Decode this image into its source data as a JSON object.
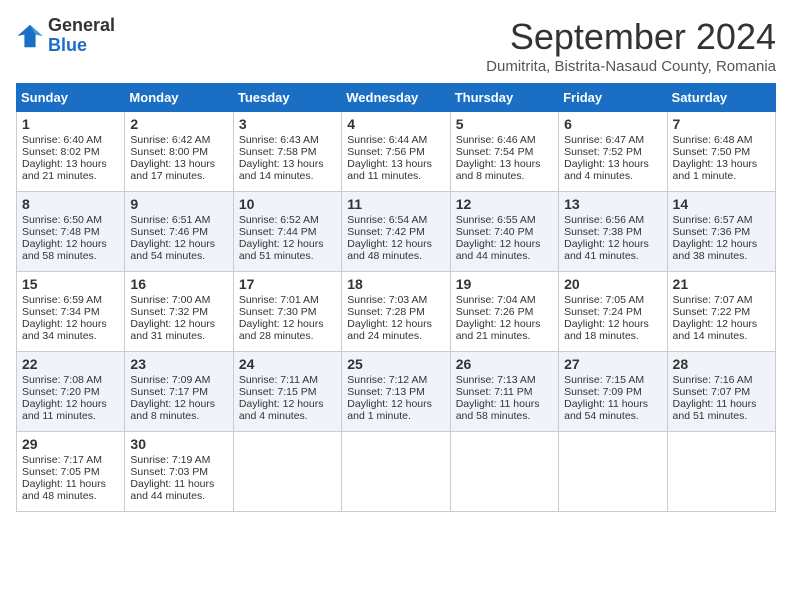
{
  "header": {
    "logo_general": "General",
    "logo_blue": "Blue",
    "month_title": "September 2024",
    "subtitle": "Dumitrita, Bistrita-Nasaud County, Romania"
  },
  "columns": [
    "Sunday",
    "Monday",
    "Tuesday",
    "Wednesday",
    "Thursday",
    "Friday",
    "Saturday"
  ],
  "weeks": [
    [
      {
        "day": "1",
        "lines": [
          "Sunrise: 6:40 AM",
          "Sunset: 8:02 PM",
          "Daylight: 13 hours",
          "and 21 minutes."
        ]
      },
      {
        "day": "2",
        "lines": [
          "Sunrise: 6:42 AM",
          "Sunset: 8:00 PM",
          "Daylight: 13 hours",
          "and 17 minutes."
        ]
      },
      {
        "day": "3",
        "lines": [
          "Sunrise: 6:43 AM",
          "Sunset: 7:58 PM",
          "Daylight: 13 hours",
          "and 14 minutes."
        ]
      },
      {
        "day": "4",
        "lines": [
          "Sunrise: 6:44 AM",
          "Sunset: 7:56 PM",
          "Daylight: 13 hours",
          "and 11 minutes."
        ]
      },
      {
        "day": "5",
        "lines": [
          "Sunrise: 6:46 AM",
          "Sunset: 7:54 PM",
          "Daylight: 13 hours",
          "and 8 minutes."
        ]
      },
      {
        "day": "6",
        "lines": [
          "Sunrise: 6:47 AM",
          "Sunset: 7:52 PM",
          "Daylight: 13 hours",
          "and 4 minutes."
        ]
      },
      {
        "day": "7",
        "lines": [
          "Sunrise: 6:48 AM",
          "Sunset: 7:50 PM",
          "Daylight: 13 hours",
          "and 1 minute."
        ]
      }
    ],
    [
      {
        "day": "8",
        "lines": [
          "Sunrise: 6:50 AM",
          "Sunset: 7:48 PM",
          "Daylight: 12 hours",
          "and 58 minutes."
        ]
      },
      {
        "day": "9",
        "lines": [
          "Sunrise: 6:51 AM",
          "Sunset: 7:46 PM",
          "Daylight: 12 hours",
          "and 54 minutes."
        ]
      },
      {
        "day": "10",
        "lines": [
          "Sunrise: 6:52 AM",
          "Sunset: 7:44 PM",
          "Daylight: 12 hours",
          "and 51 minutes."
        ]
      },
      {
        "day": "11",
        "lines": [
          "Sunrise: 6:54 AM",
          "Sunset: 7:42 PM",
          "Daylight: 12 hours",
          "and 48 minutes."
        ]
      },
      {
        "day": "12",
        "lines": [
          "Sunrise: 6:55 AM",
          "Sunset: 7:40 PM",
          "Daylight: 12 hours",
          "and 44 minutes."
        ]
      },
      {
        "day": "13",
        "lines": [
          "Sunrise: 6:56 AM",
          "Sunset: 7:38 PM",
          "Daylight: 12 hours",
          "and 41 minutes."
        ]
      },
      {
        "day": "14",
        "lines": [
          "Sunrise: 6:57 AM",
          "Sunset: 7:36 PM",
          "Daylight: 12 hours",
          "and 38 minutes."
        ]
      }
    ],
    [
      {
        "day": "15",
        "lines": [
          "Sunrise: 6:59 AM",
          "Sunset: 7:34 PM",
          "Daylight: 12 hours",
          "and 34 minutes."
        ]
      },
      {
        "day": "16",
        "lines": [
          "Sunrise: 7:00 AM",
          "Sunset: 7:32 PM",
          "Daylight: 12 hours",
          "and 31 minutes."
        ]
      },
      {
        "day": "17",
        "lines": [
          "Sunrise: 7:01 AM",
          "Sunset: 7:30 PM",
          "Daylight: 12 hours",
          "and 28 minutes."
        ]
      },
      {
        "day": "18",
        "lines": [
          "Sunrise: 7:03 AM",
          "Sunset: 7:28 PM",
          "Daylight: 12 hours",
          "and 24 minutes."
        ]
      },
      {
        "day": "19",
        "lines": [
          "Sunrise: 7:04 AM",
          "Sunset: 7:26 PM",
          "Daylight: 12 hours",
          "and 21 minutes."
        ]
      },
      {
        "day": "20",
        "lines": [
          "Sunrise: 7:05 AM",
          "Sunset: 7:24 PM",
          "Daylight: 12 hours",
          "and 18 minutes."
        ]
      },
      {
        "day": "21",
        "lines": [
          "Sunrise: 7:07 AM",
          "Sunset: 7:22 PM",
          "Daylight: 12 hours",
          "and 14 minutes."
        ]
      }
    ],
    [
      {
        "day": "22",
        "lines": [
          "Sunrise: 7:08 AM",
          "Sunset: 7:20 PM",
          "Daylight: 12 hours",
          "and 11 minutes."
        ]
      },
      {
        "day": "23",
        "lines": [
          "Sunrise: 7:09 AM",
          "Sunset: 7:17 PM",
          "Daylight: 12 hours",
          "and 8 minutes."
        ]
      },
      {
        "day": "24",
        "lines": [
          "Sunrise: 7:11 AM",
          "Sunset: 7:15 PM",
          "Daylight: 12 hours",
          "and 4 minutes."
        ]
      },
      {
        "day": "25",
        "lines": [
          "Sunrise: 7:12 AM",
          "Sunset: 7:13 PM",
          "Daylight: 12 hours",
          "and 1 minute."
        ]
      },
      {
        "day": "26",
        "lines": [
          "Sunrise: 7:13 AM",
          "Sunset: 7:11 PM",
          "Daylight: 11 hours",
          "and 58 minutes."
        ]
      },
      {
        "day": "27",
        "lines": [
          "Sunrise: 7:15 AM",
          "Sunset: 7:09 PM",
          "Daylight: 11 hours",
          "and 54 minutes."
        ]
      },
      {
        "day": "28",
        "lines": [
          "Sunrise: 7:16 AM",
          "Sunset: 7:07 PM",
          "Daylight: 11 hours",
          "and 51 minutes."
        ]
      }
    ],
    [
      {
        "day": "29",
        "lines": [
          "Sunrise: 7:17 AM",
          "Sunset: 7:05 PM",
          "Daylight: 11 hours",
          "and 48 minutes."
        ]
      },
      {
        "day": "30",
        "lines": [
          "Sunrise: 7:19 AM",
          "Sunset: 7:03 PM",
          "Daylight: 11 hours",
          "and 44 minutes."
        ]
      },
      {
        "day": "",
        "lines": []
      },
      {
        "day": "",
        "lines": []
      },
      {
        "day": "",
        "lines": []
      },
      {
        "day": "",
        "lines": []
      },
      {
        "day": "",
        "lines": []
      }
    ]
  ]
}
